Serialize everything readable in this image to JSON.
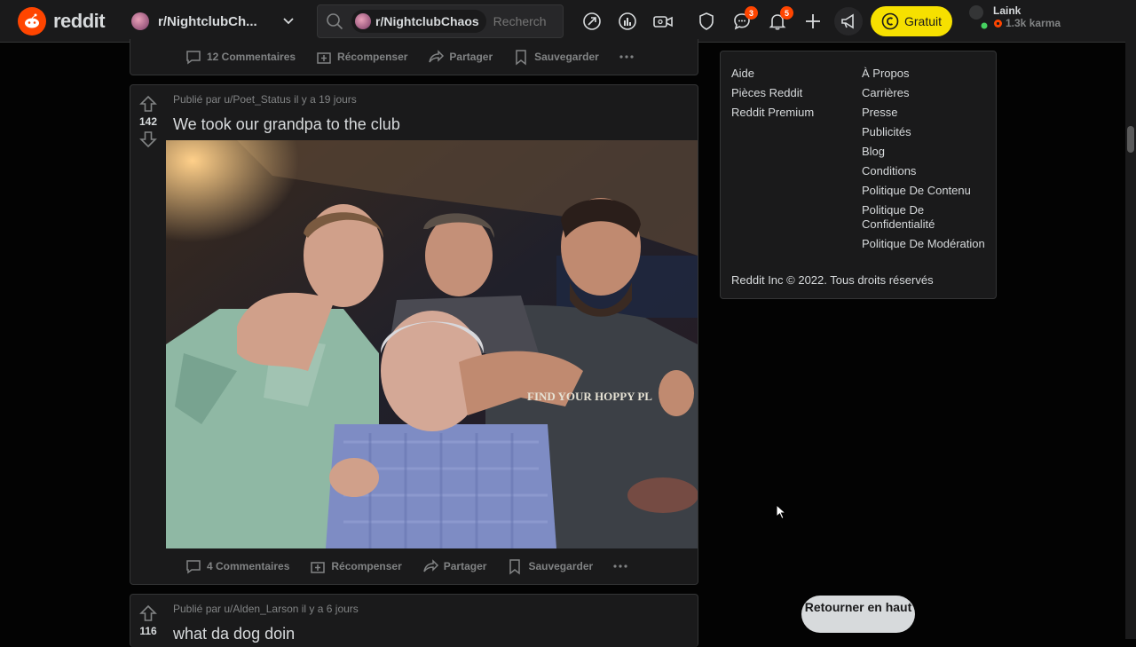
{
  "header": {
    "logo_text": "reddit",
    "subreddit_select": "r/NightclubCh...",
    "search_chip": "r/NightclubChaos",
    "search_placeholder": "Rechercher",
    "chat_badge": "3",
    "notif_badge": "5",
    "premium_label": "Gratuit",
    "username": "Laink",
    "karma": "1.3k karma"
  },
  "post_top": {
    "actions": [
      "12 Commentaires",
      "Récompenser",
      "Partager",
      "Sauvegarder"
    ]
  },
  "post_main": {
    "meta": "Publié par u/Poet_Status il y a 19 jours",
    "score": "142",
    "title": "We took our grandpa to the club",
    "shirt_text": "FIND YOUR HOPPY PL",
    "actions": [
      "4 Commentaires",
      "Récompenser",
      "Partager",
      "Sauvegarder"
    ]
  },
  "post_next": {
    "meta": "Publié par u/Alden_Larson il y a 6 jours",
    "score": "116",
    "title": "what da dog doin"
  },
  "footer_links": {
    "col1": [
      "Aide",
      "Pièces Reddit",
      "Reddit Premium"
    ],
    "col2": [
      "À Propos",
      "Carrières",
      "Presse",
      "Publicités",
      "Blog",
      "Conditions",
      "Politique De Contenu",
      "Politique De Confidentialité",
      "Politique De Modération"
    ],
    "copyright": "Reddit Inc © 2022. Tous droits réservés"
  },
  "back_to_top": "Retourner en haut",
  "colors": {
    "accent": "#ff4500",
    "premium": "#f6e000",
    "bg": "#030303",
    "card": "#1a1a1b"
  }
}
